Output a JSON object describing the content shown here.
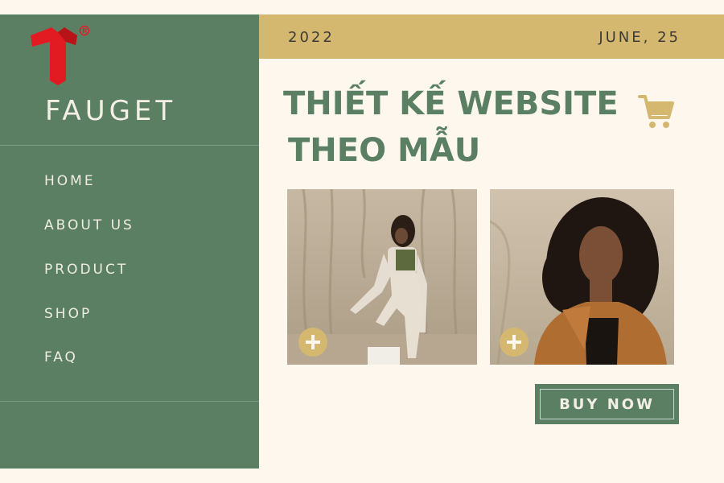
{
  "sidebar": {
    "brand": "FAUGET",
    "logo": {
      "letter": "T",
      "mark": "®",
      "color": "#e21b23"
    },
    "nav": [
      {
        "label": "HOME"
      },
      {
        "label": "ABOUT US"
      },
      {
        "label": "PRODUCT"
      },
      {
        "label": "SHOP"
      },
      {
        "label": "FAQ"
      }
    ]
  },
  "topbar": {
    "year": "2022",
    "date": "JUNE, 25"
  },
  "headline": {
    "line1": "THIẾT KẾ WEBSITE",
    "line2": "THEO MẪU"
  },
  "cart_icon": "shopping-cart-icon",
  "products": [
    {
      "description": "woman in beige suit standing in desert canyon",
      "action_icon": "plus-icon"
    },
    {
      "description": "woman with curly hair in orange hoodie",
      "action_icon": "plus-icon"
    }
  ],
  "buy_button": {
    "label": "BUY NOW"
  },
  "colors": {
    "sidebar_green": "#5a7f62",
    "gold": "#d5b870",
    "background": "#fdf7ee",
    "logo_red": "#e21b23"
  }
}
